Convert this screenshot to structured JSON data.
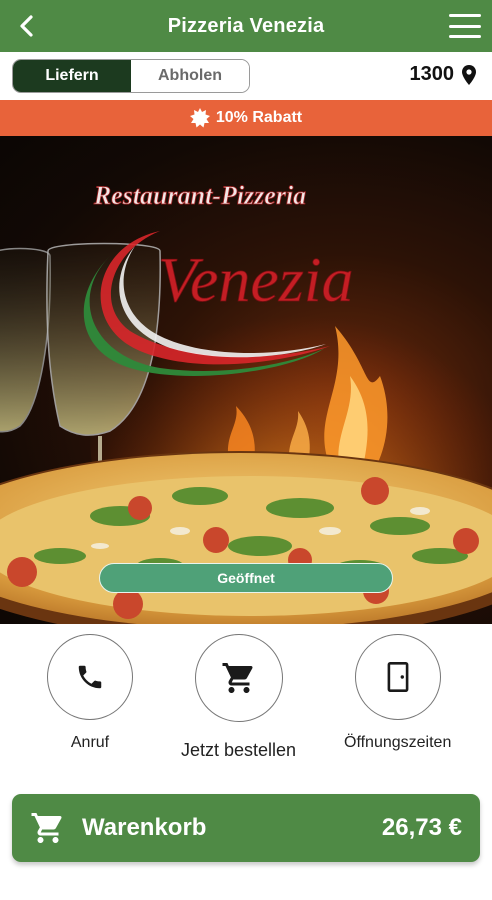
{
  "header": {
    "title": "Pizzeria Venezia",
    "back_icon": "back-arrow-icon",
    "menu_icon": "hamburger-menu-icon"
  },
  "mode": {
    "options": [
      "Liefern",
      "Abholen"
    ],
    "selected": "Liefern",
    "zip": "1300",
    "zip_icon": "location-pin-icon"
  },
  "discount": {
    "icon": "starburst-icon",
    "text": "10% Rabatt"
  },
  "hero": {
    "logo_top": "Restaurant-Pizzeria",
    "logo_main": "Venezia",
    "status": "Geöffnet"
  },
  "actions": [
    {
      "label": "Anruf",
      "icon": "phone-icon"
    },
    {
      "label": "Jetzt bestellen",
      "icon": "shopping-cart-icon"
    },
    {
      "label": "Öffnungszeiten",
      "icon": "door-icon"
    }
  ],
  "cart": {
    "label": "Warenkorb",
    "total": "26,73 €",
    "icon": "shopping-cart-icon"
  },
  "colors": {
    "primary": "#4f8a45",
    "dark_toggle": "#1c3a1f",
    "discount": "#e8633a",
    "open_pill": "#4fa178"
  }
}
